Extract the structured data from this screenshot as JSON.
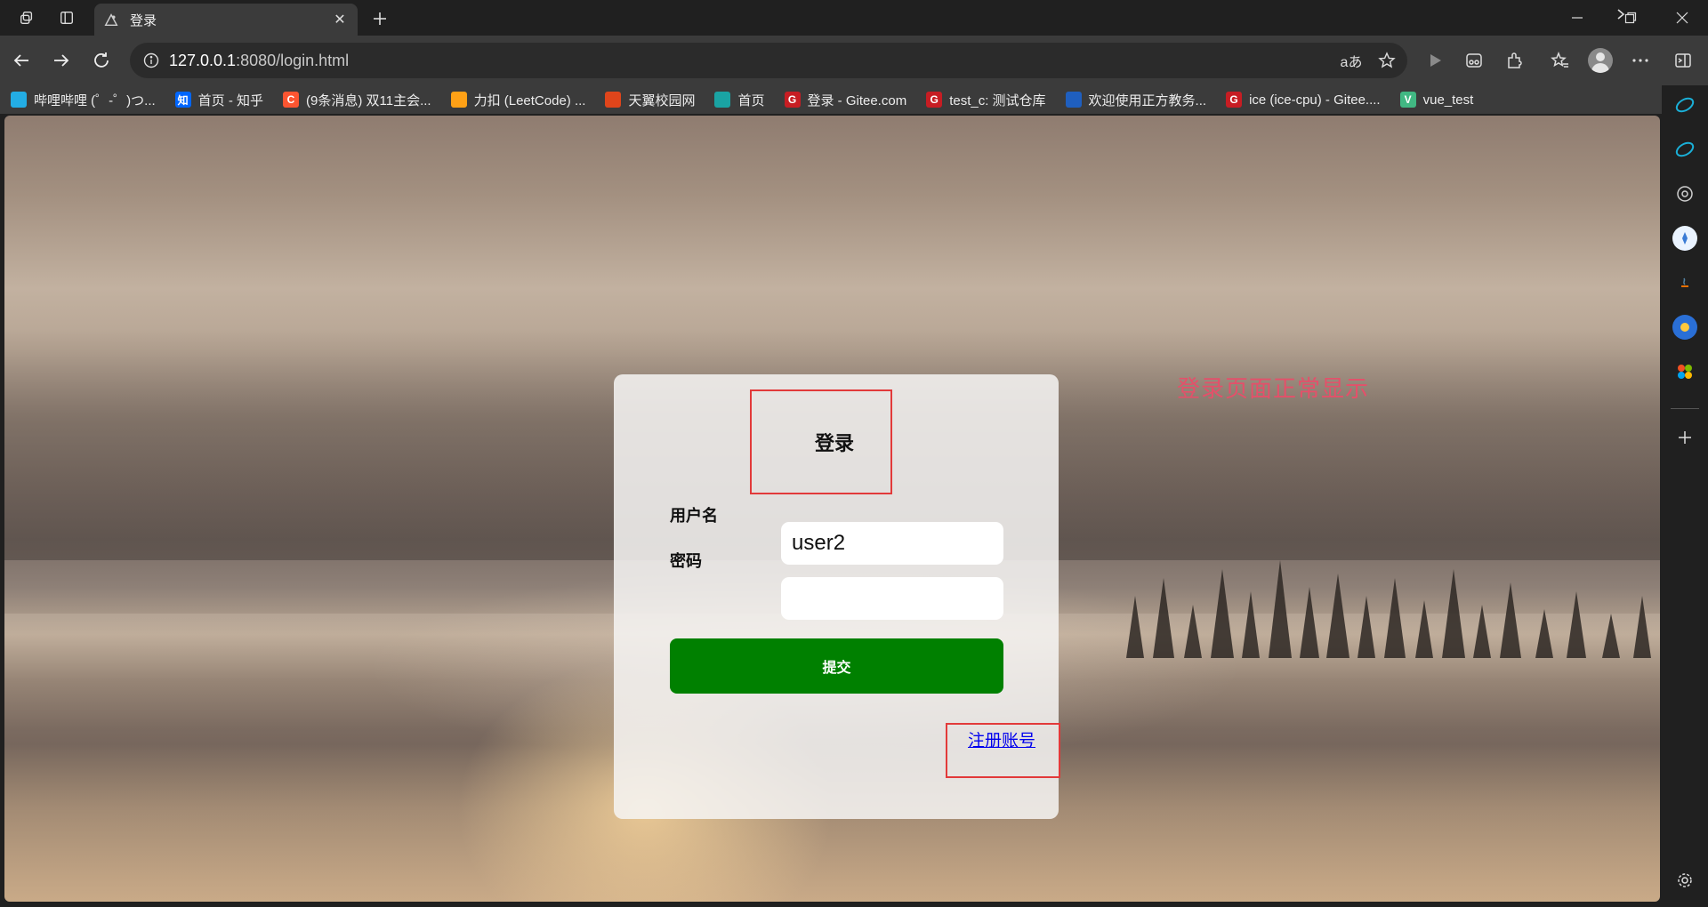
{
  "browser": {
    "tab_title": "登录",
    "url_host": "127.0.0.1",
    "url_path": ":8080/login.html",
    "bookmarks": [
      {
        "label": "哔哩哔哩 (゜-゜)つ...",
        "icon": "bilibili-icon",
        "color": "#23ade5"
      },
      {
        "label": "首页 - 知乎",
        "icon": "zhihu-icon",
        "color": "#0066ff",
        "glyph": "知"
      },
      {
        "label": "(9条消息) 双11主会...",
        "icon": "csdn-icon",
        "color": "#fc5531",
        "glyph": "C"
      },
      {
        "label": "力扣 (LeetCode) ...",
        "icon": "leetcode-icon",
        "color": "#ffa116"
      },
      {
        "label": "天翼校园网",
        "icon": "tianyi-icon",
        "color": "#e0451b"
      },
      {
        "label": "首页",
        "icon": "leaf-icon",
        "color": "#1aa3a3"
      },
      {
        "label": "登录 - Gitee.com",
        "icon": "gitee-icon",
        "color": "#c71d23",
        "glyph": "G"
      },
      {
        "label": "test_c: 测试仓库",
        "icon": "gitee-icon",
        "color": "#c71d23",
        "glyph": "G"
      },
      {
        "label": "欢迎使用正方教务...",
        "icon": "zhengfang-icon",
        "color": "#1f5fbf"
      },
      {
        "label": "ice (ice-cpu) - Gitee....",
        "icon": "gitee-icon",
        "color": "#c71d23",
        "glyph": "G"
      },
      {
        "label": "vue_test",
        "icon": "vue-icon",
        "color": "#41b883",
        "glyph": "V"
      }
    ]
  },
  "login": {
    "title": "登录",
    "username_label": "用户名",
    "username_value": "user2",
    "password_label": "密码",
    "password_value": "",
    "submit_label": "提交",
    "register_link": "注册账号"
  },
  "annotation": "登录页面正常显示",
  "colors": {
    "highlight_box": "#e23a3a",
    "submit_bg": "#008000",
    "link": "#0000ee",
    "annotation": "#e4506a"
  }
}
